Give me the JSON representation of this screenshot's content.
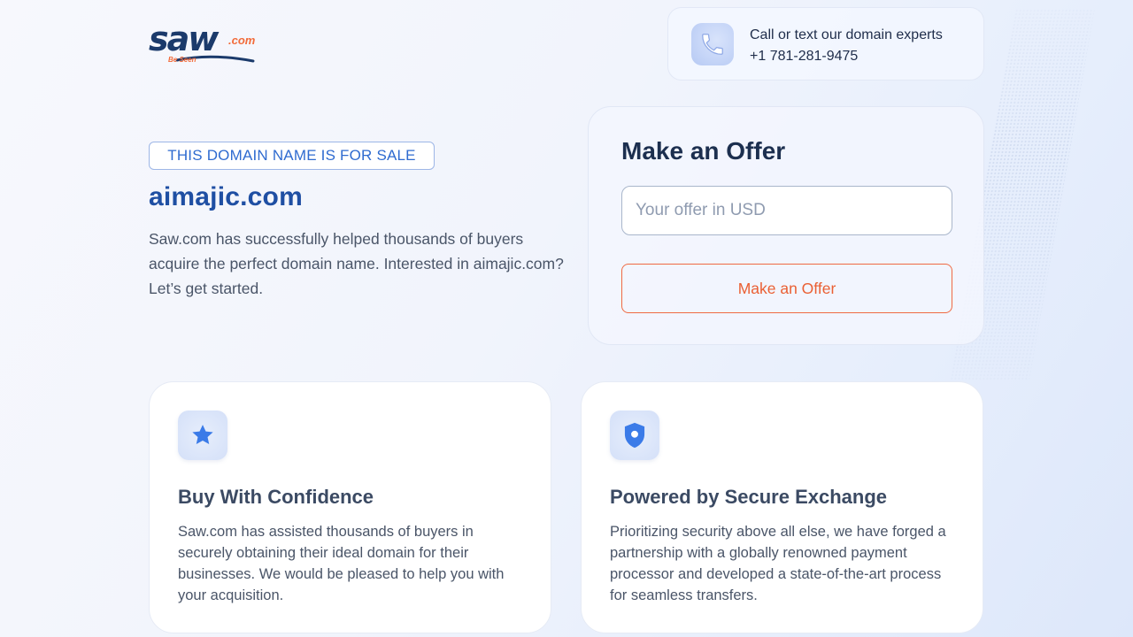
{
  "logo": {
    "main": "saw",
    "com": ".com",
    "tagline": "Be Seen"
  },
  "contact": {
    "line1": "Call or text our domain experts",
    "phone": "+1 781-281-9475",
    "icon": "phone-icon"
  },
  "hero": {
    "badge": "THIS DOMAIN NAME IS FOR SALE",
    "domain": "aimajic.com",
    "description": "Saw.com has successfully helped thousands of buyers acquire the perfect domain name. Interested in aimajic.com? Let’s get started."
  },
  "offer": {
    "title": "Make an Offer",
    "input_placeholder": "Your offer in USD",
    "input_value": "",
    "button_label": "Make an Offer"
  },
  "features": [
    {
      "icon": "star-icon",
      "title": "Buy With Confidence",
      "description": "Saw.com has assisted thousands of buyers in securely obtaining their ideal domain for their businesses. We would be pleased to help you with your acquisition."
    },
    {
      "icon": "shield-icon",
      "title": "Powered by Secure Exchange",
      "description": "Prioritizing security above all else, we have forged a partnership with a globally renowned payment processor and developed a state-of-the-art process for seamless transfers."
    }
  ],
  "colors": {
    "brand_navy": "#1b3a6b",
    "brand_orange": "#f26b3a",
    "domain_blue": "#1f4fa3",
    "badge_blue": "#2f6bd0",
    "icon_blue": "#3b7be8"
  }
}
